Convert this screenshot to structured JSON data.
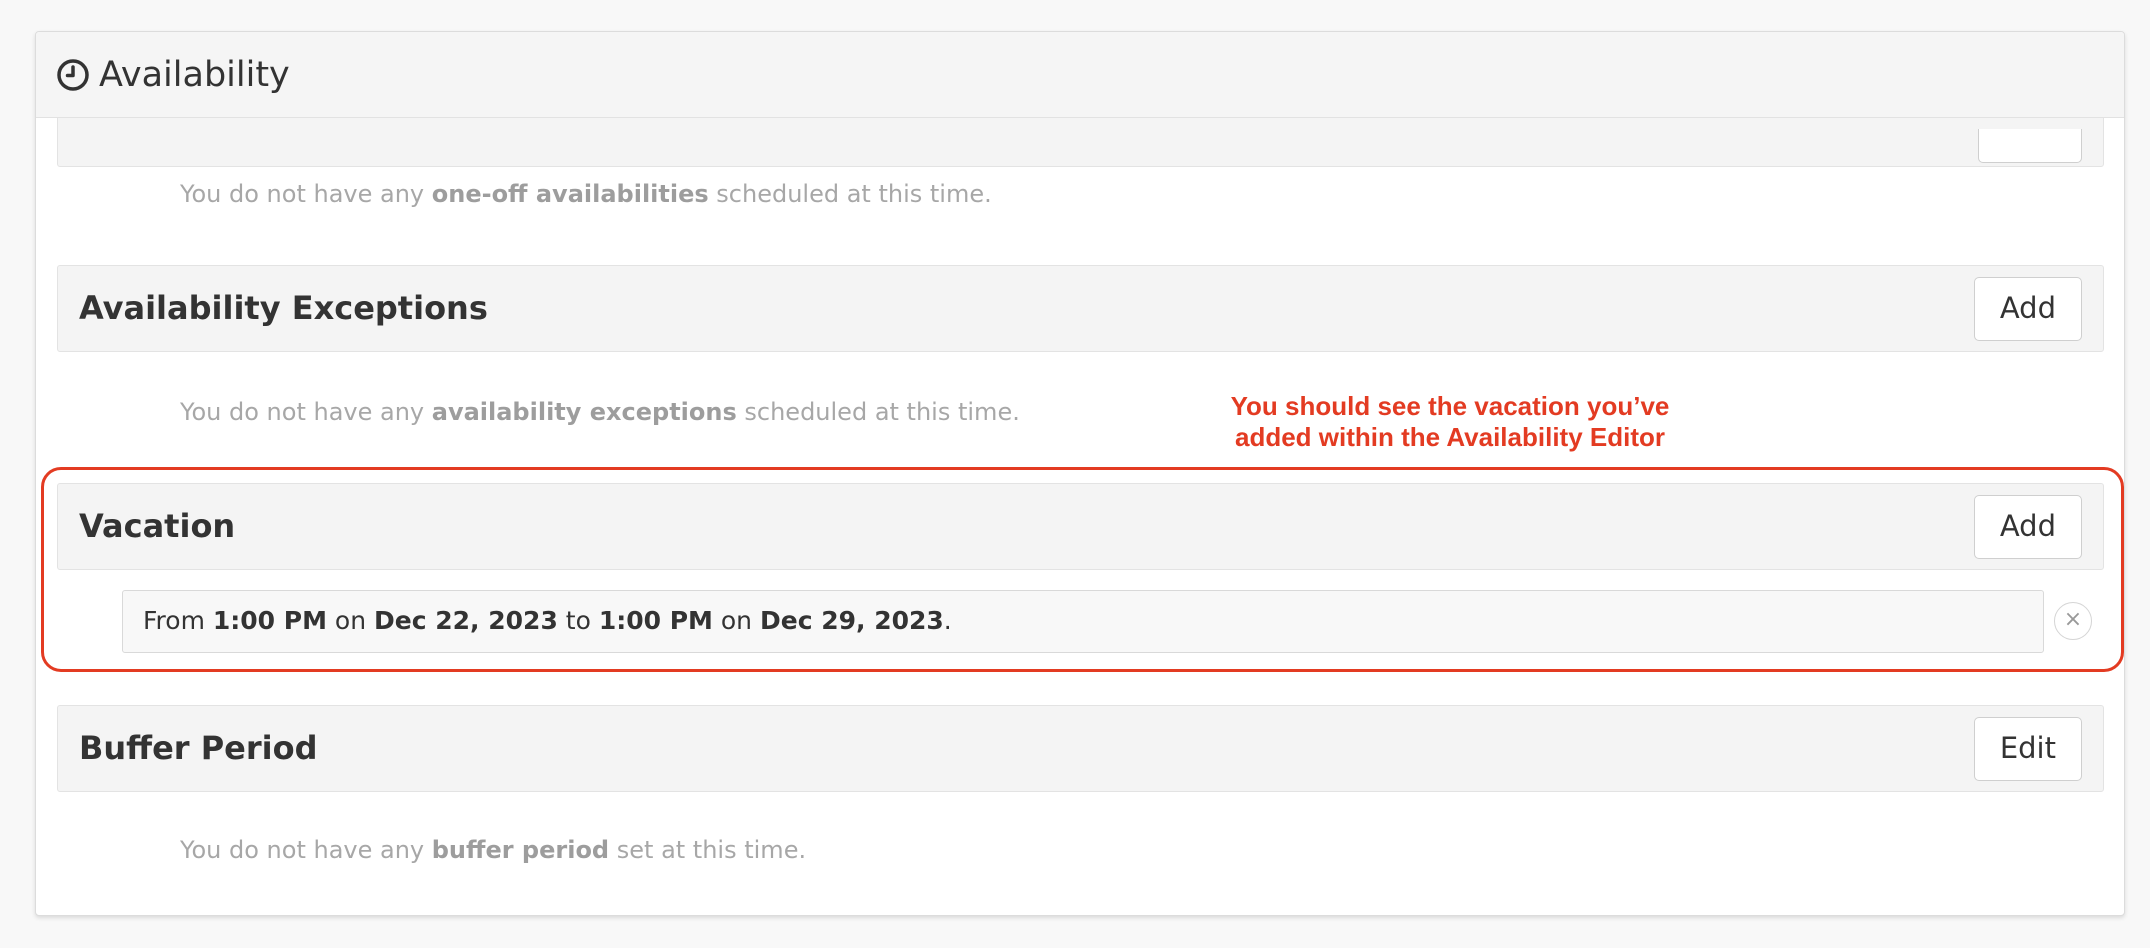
{
  "panel": {
    "title": "Availability",
    "icon": "clock-icon"
  },
  "one_off": {
    "button_label": "",
    "empty_prefix": "You do not have any ",
    "empty_bold": "one-off availabilities",
    "empty_suffix": " scheduled at this time."
  },
  "exceptions": {
    "title": "Availability Exceptions",
    "add_label": "Add",
    "empty_prefix": "You do not have any ",
    "empty_bold": "availability exceptions",
    "empty_suffix": " scheduled at this time."
  },
  "vacation": {
    "title": "Vacation",
    "add_label": "Add",
    "entry": {
      "from_word": "From ",
      "start_time": "1:00 PM",
      "on_word_1": " on ",
      "start_date": "Dec 22, 2023",
      "to_word": " to ",
      "end_time": "1:00 PM",
      "on_word_2": " on ",
      "end_date": "Dec 29, 2023",
      "end_punct": "."
    },
    "remove_label": "×"
  },
  "buffer": {
    "title": "Buffer Period",
    "edit_label": "Edit",
    "empty_prefix": "You do not have any ",
    "empty_bold": "buffer period",
    "empty_suffix": " set at this time."
  },
  "annotation": {
    "line1": "You should see the vacation you’ve",
    "line2": "added within the Availability Editor",
    "color": "#e33b22"
  }
}
